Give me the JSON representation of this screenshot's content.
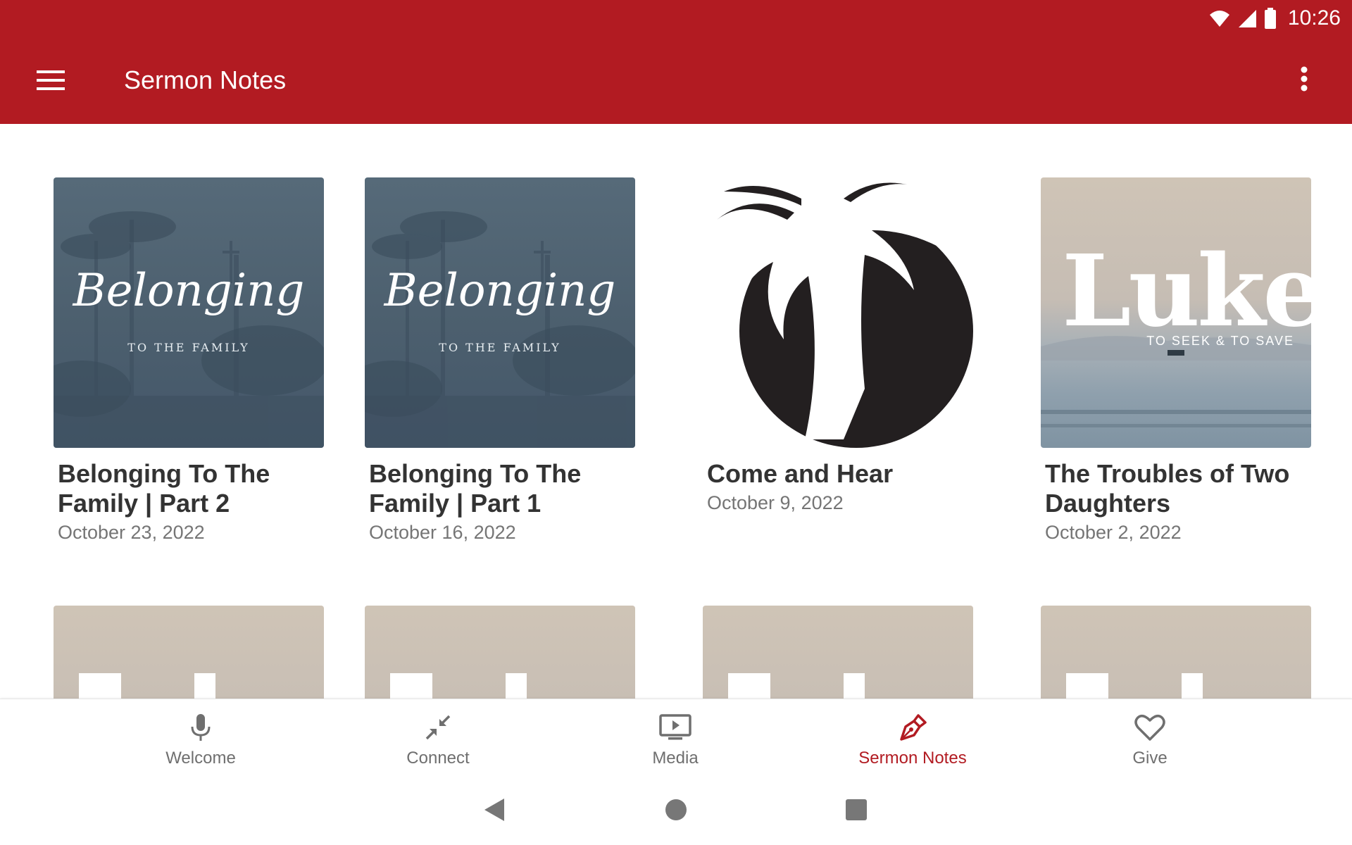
{
  "status_bar": {
    "time": "10:26"
  },
  "app_bar": {
    "title": "Sermon Notes",
    "menu_icon": "hamburger-menu-icon",
    "overflow_icon": "more-vert-icon"
  },
  "sermons": [
    {
      "title": "Belonging To The Family | Part 2",
      "date": "October 23, 2022",
      "artwork_title": "Belonging",
      "artwork_subtitle": "TO THE FAMILY"
    },
    {
      "title": "Belonging To The Family | Part 1",
      "date": "October 16, 2022",
      "artwork_title": "Belonging",
      "artwork_subtitle": "TO THE FAMILY"
    },
    {
      "title": "Come and Hear",
      "date": "October 9, 2022"
    },
    {
      "title": "The Troubles of Two Daughters",
      "date": "October 2, 2022",
      "artwork_title": "Luke",
      "artwork_subtitle": "TO SEEK & TO SAVE"
    }
  ],
  "bottom_nav": {
    "items": [
      {
        "label": "Welcome",
        "icon": "microphone-icon"
      },
      {
        "label": "Connect",
        "icon": "compress-arrows-icon"
      },
      {
        "label": "Media",
        "icon": "tv-play-icon"
      },
      {
        "label": "Sermon Notes",
        "icon": "pen-nib-icon"
      },
      {
        "label": "Give",
        "icon": "heart-icon"
      }
    ],
    "active": "Sermon Notes"
  },
  "colors": {
    "primary": "#b21b22",
    "title_text": "#333333",
    "date_text": "#757575",
    "nav_inactive": "#6f6f6f"
  },
  "system_nav": {
    "back_icon": "back-triangle-icon",
    "home_icon": "home-circle-icon",
    "recents_icon": "recents-square-icon"
  }
}
